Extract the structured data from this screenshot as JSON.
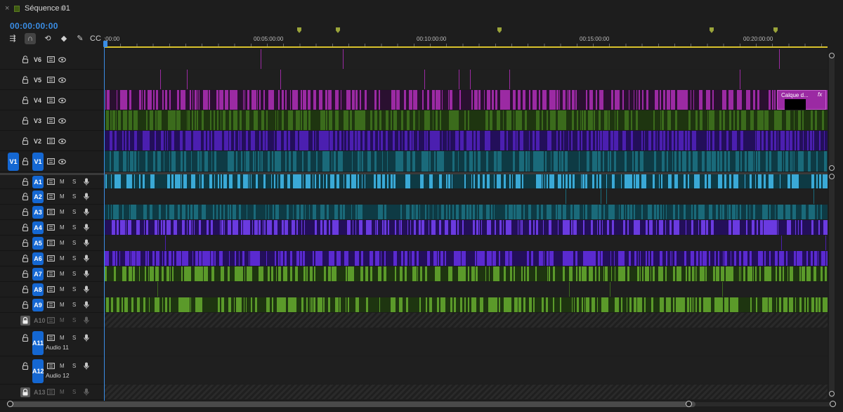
{
  "tab": {
    "title": "Séquence 01",
    "close_glyph": "×",
    "menu_glyph": "≡"
  },
  "timecode": "00:00:00:00",
  "tools": [
    {
      "name": "insert-icon",
      "glyph": "⇶"
    },
    {
      "name": "snap-magnet-icon",
      "glyph": "∩",
      "active": true
    },
    {
      "name": "linked-selection-icon",
      "glyph": "⟲"
    },
    {
      "name": "add-marker-icon",
      "glyph": "◆"
    },
    {
      "name": "wrench-icon",
      "glyph": "✎"
    },
    {
      "name": "captions-icon",
      "glyph": "CC"
    }
  ],
  "ruler": {
    "labels": [
      ":00:00",
      "00:05:00:00",
      "00:10:00:00",
      "00:15:00:00",
      "00:20:00:00"
    ]
  },
  "video_tracks": [
    {
      "name": "V6"
    },
    {
      "name": "V5"
    },
    {
      "name": "V4"
    },
    {
      "name": "V3"
    },
    {
      "name": "V2"
    },
    {
      "name": "V1",
      "source_patch": "V1",
      "targeted": true
    }
  ],
  "audio_tracks": [
    {
      "name": "A1",
      "targeted": true
    },
    {
      "name": "A2",
      "targeted": true
    },
    {
      "name": "A3",
      "targeted": true
    },
    {
      "name": "A4",
      "targeted": true
    },
    {
      "name": "A5",
      "targeted": true
    },
    {
      "name": "A6",
      "targeted": true
    },
    {
      "name": "A7",
      "targeted": true
    },
    {
      "name": "A8",
      "targeted": true
    },
    {
      "name": "A9",
      "targeted": true
    },
    {
      "name": "A10",
      "locked": true
    },
    {
      "name": "A11",
      "targeted": true,
      "label": "Audio 11"
    },
    {
      "name": "A12",
      "targeted": true,
      "label": "Audio 12"
    },
    {
      "name": "A13",
      "locked": true
    }
  ],
  "buttons": {
    "mute": "M",
    "solo": "S"
  },
  "clip": {
    "label": "Calque d...",
    "fx": "fx"
  },
  "colors": {
    "accent": "#1467d2",
    "timecode": "#3a8ee6",
    "magenta": "#9b2aa3",
    "green": "#3b6b1c",
    "violet": "#4b1fb0",
    "teal": "#1a6a7a",
    "playhead_bar": "#d8c12c"
  }
}
